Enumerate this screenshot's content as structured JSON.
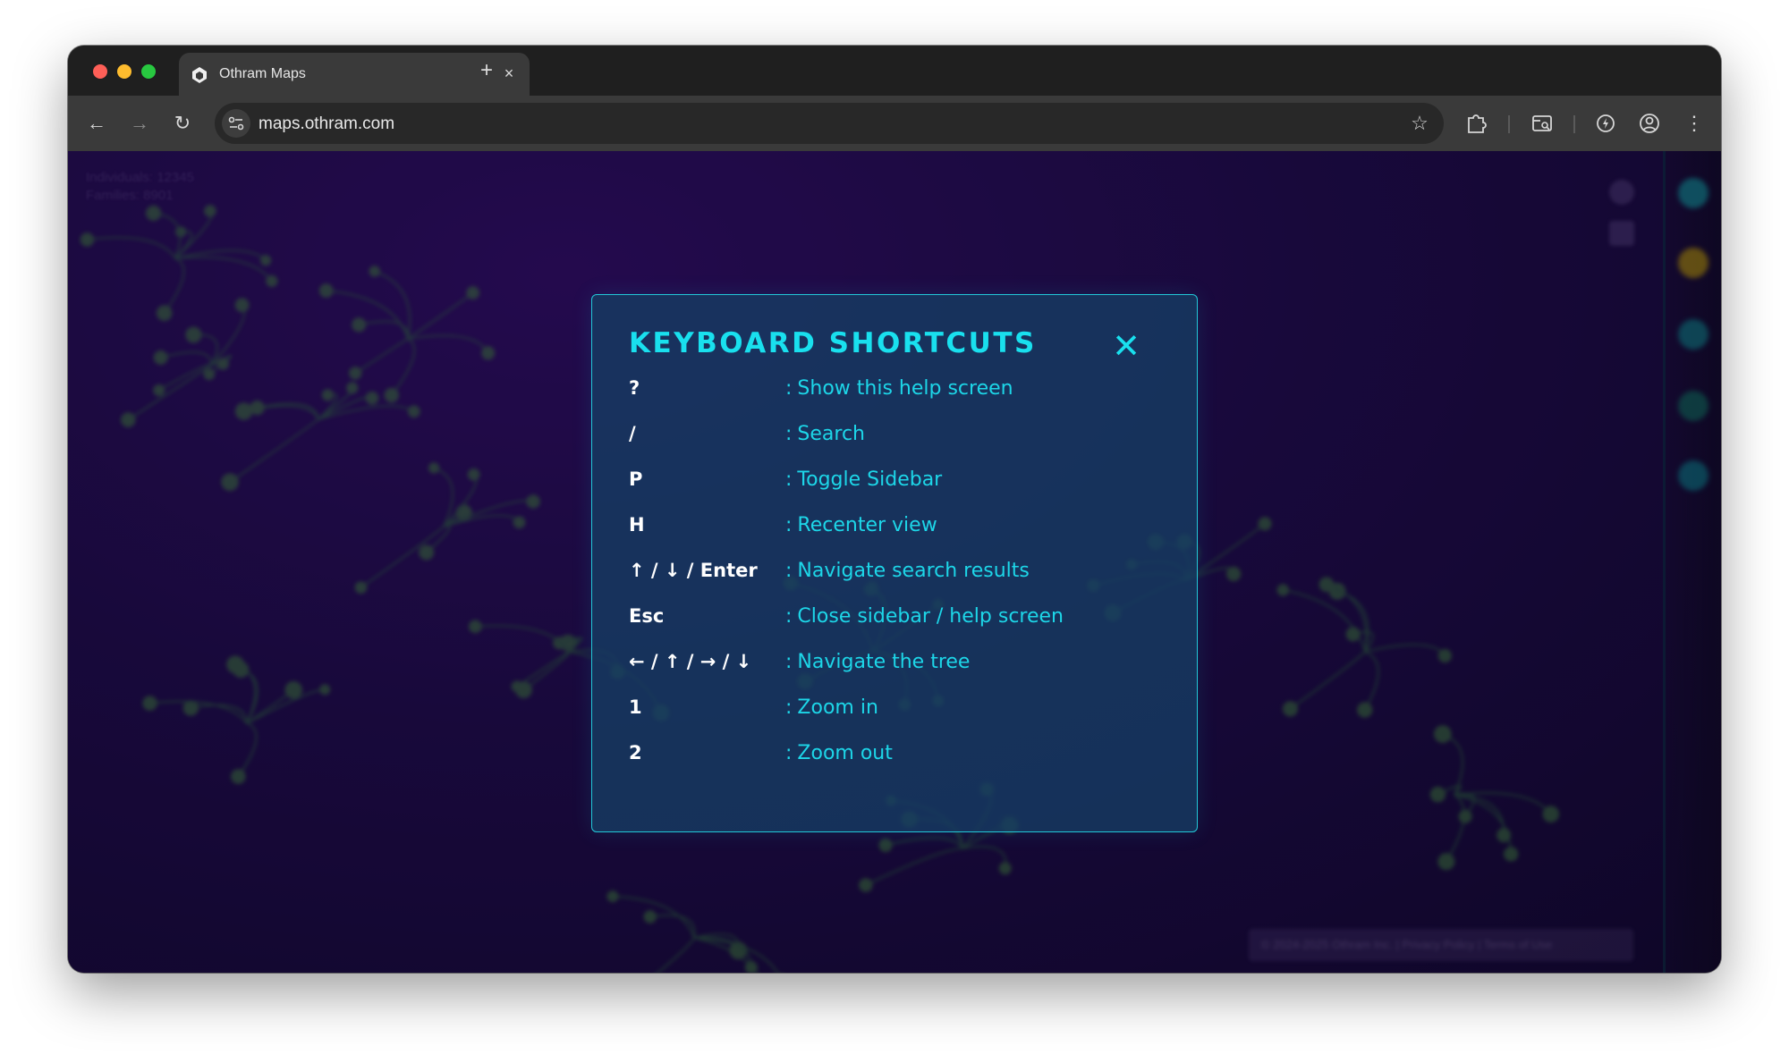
{
  "browser": {
    "tab_title": "Othram Maps",
    "tab_close_glyph": "×",
    "new_tab_glyph": "+",
    "url": "maps.othram.com",
    "back_glyph": "←",
    "forward_glyph": "→",
    "reload_glyph": "↻",
    "bookmark_glyph": "☆",
    "menu_glyph": "⋮"
  },
  "map": {
    "stats_line1": "Individuals: 12345",
    "stats_line2": "Families: 8901",
    "footer": "© 2024-2025 Othram Inc. | Privacy Policy | Terms of Use"
  },
  "modal": {
    "title": "KEYBOARD SHORTCUTS",
    "close_glyph": "✕",
    "colon": ":",
    "shortcuts": [
      {
        "key": "?",
        "desc": "Show this help screen"
      },
      {
        "key": "/",
        "desc": "Search"
      },
      {
        "key": "P",
        "desc": "Toggle Sidebar"
      },
      {
        "key": "H",
        "desc": "Recenter view"
      },
      {
        "key": "↑ / ↓ / Enter",
        "desc": "Navigate search results"
      },
      {
        "key": "Esc",
        "desc": "Close sidebar / help screen"
      },
      {
        "key": "← / ↑ / → / ↓",
        "desc": "Navigate the tree"
      },
      {
        "key": "1",
        "desc": "Zoom in"
      },
      {
        "key": "2",
        "desc": "Zoom out"
      }
    ]
  },
  "colors": {
    "accent_cyan": "#19e0ee",
    "page_background": "#1d0a44",
    "tree_nodes": "#3f7a3a"
  }
}
